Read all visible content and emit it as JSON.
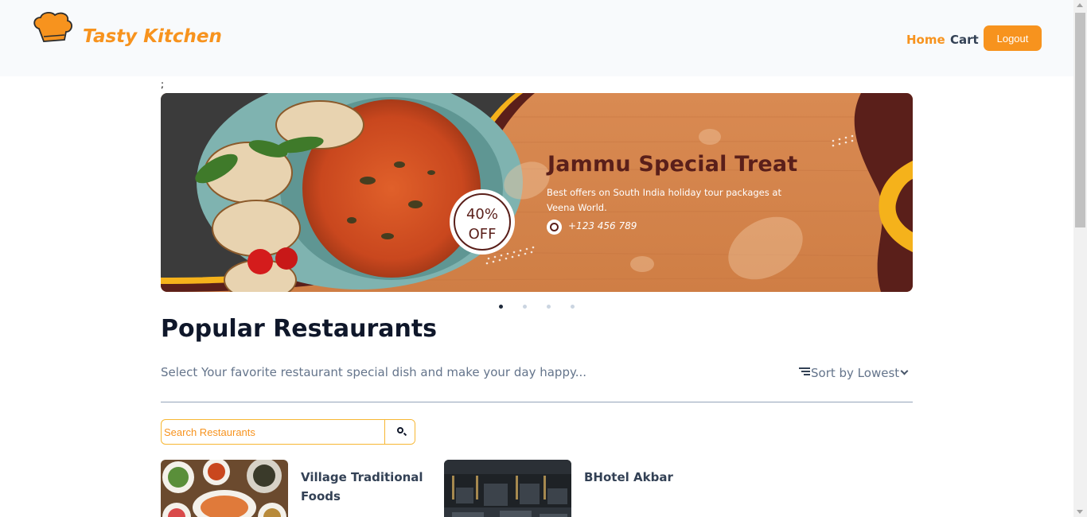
{
  "header": {
    "brand": "Tasty Kitchen",
    "nav": {
      "home": "Home",
      "cart": "Cart"
    },
    "logout_label": "Logout",
    "logo_icon": "chef-hat-icon"
  },
  "stray_text": ";",
  "banner": {
    "title": "Jammu Special Treat",
    "subtitle": "Best offers on South India holiday tour packages at Veena World.",
    "phone": "+123 456 789",
    "offer_line1": "40%",
    "offer_line2": "OFF",
    "phone_icon": "whatsapp-icon"
  },
  "carousel": {
    "slides": 4,
    "active": 1
  },
  "section": {
    "title": "Popular Restaurants",
    "description": "Select Your favorite restaurant special dish and make your day happy...",
    "sort_label": "Sort by Lowest"
  },
  "search": {
    "placeholder": "Search Restaurants",
    "value": ""
  },
  "restaurants": [
    {
      "name": "Village Traditional Foods"
    },
    {
      "name": "BHotel Akbar"
    }
  ],
  "colors": {
    "accent": "#f7931e",
    "banner_brown": "#5a1f1a",
    "banner_wood": "#d98a52"
  }
}
